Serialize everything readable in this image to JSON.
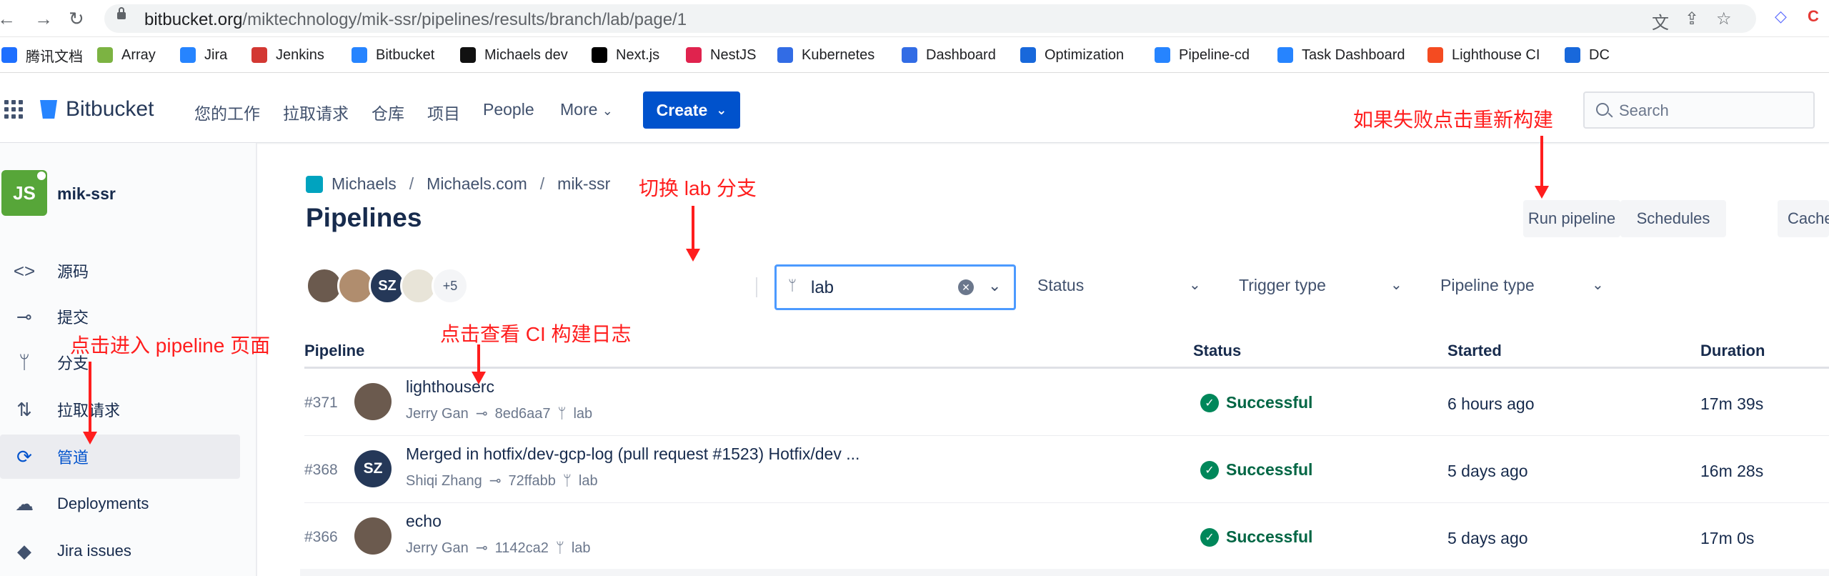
{
  "browser": {
    "url_host": "bitbucket.org",
    "url_path": "/miktechnology/mik-ssr/pipelines/results/branch/lab/page/1",
    "bookmarks": [
      {
        "label": "腾讯文档",
        "color": "#1e6fff"
      },
      {
        "label": "Array",
        "color": "#7cb342"
      },
      {
        "label": "Jira",
        "color": "#2684ff"
      },
      {
        "label": "Jenkins",
        "color": "#d33833"
      },
      {
        "label": "Bitbucket",
        "color": "#2684ff"
      },
      {
        "label": "Michaels dev",
        "color": "#111111"
      },
      {
        "label": "Next.js",
        "color": "#000000"
      },
      {
        "label": "NestJS",
        "color": "#e0234e"
      },
      {
        "label": "Kubernetes",
        "color": "#326ce5"
      },
      {
        "label": "Dashboard",
        "color": "#326ce5"
      },
      {
        "label": "Optimization",
        "color": "#1868db"
      },
      {
        "label": "Pipeline-cd",
        "color": "#2684ff"
      },
      {
        "label": "Task Dashboard",
        "color": "#2684ff"
      },
      {
        "label": "Lighthouse CI",
        "color": "#f44b21"
      },
      {
        "label": "DC",
        "color": "#1868db"
      }
    ]
  },
  "topnav": {
    "logo": "Bitbucket",
    "items": [
      "您的工作",
      "拉取请求",
      "仓库",
      "项目",
      "People",
      "More"
    ],
    "create_label": "Create",
    "search_placeholder": "Search"
  },
  "sidebar": {
    "repo_name": "mik-ssr",
    "repo_icon_text": "JS",
    "items": [
      {
        "label": "源码",
        "icon": "code-icon"
      },
      {
        "label": "提交",
        "icon": "commit-icon"
      },
      {
        "label": "分支",
        "icon": "branch-icon"
      },
      {
        "label": "拉取请求",
        "icon": "pull-request-icon"
      },
      {
        "label": "管道",
        "icon": "pipelines-icon"
      },
      {
        "label": "Deployments",
        "icon": "deployments-icon"
      },
      {
        "label": "Jira issues",
        "icon": "jira-icon"
      }
    ]
  },
  "main": {
    "breadcrumbs": [
      "Michaels",
      "Michaels.com",
      "mik-ssr"
    ],
    "title": "Pipelines",
    "buttons": {
      "run": "Run pipeline",
      "schedules": "Schedules",
      "caches": "Caches"
    },
    "avatars": [
      {
        "initials": "",
        "color": "#6b5a4e"
      },
      {
        "initials": "",
        "color": "#b08d6e"
      },
      {
        "initials": "SZ",
        "color": "#253858"
      },
      {
        "initials": "",
        "color": "#e8e4d8"
      }
    ],
    "avatars_more": "+5",
    "filters": {
      "branch_value": "lab",
      "status": "Status",
      "trigger": "Trigger type",
      "pipeline_type": "Pipeline type"
    },
    "table": {
      "headers": {
        "pipeline": "Pipeline",
        "status": "Status",
        "started": "Started",
        "duration": "Duration"
      },
      "rows": [
        {
          "num": "#371",
          "title": "lighthouserc",
          "author": "Jerry Gan",
          "commit": "8ed6aa7",
          "branch": "lab",
          "status": "Successful",
          "started": "6 hours ago",
          "duration": "17m 39s",
          "avatar_initials": "",
          "avatar_color": "#6b5a4e"
        },
        {
          "num": "#368",
          "title": "Merged in hotfix/dev-gcp-log (pull request #1523) Hotfix/dev ...",
          "author": "Shiqi Zhang",
          "commit": "72ffabb",
          "branch": "lab",
          "status": "Successful",
          "started": "5 days ago",
          "duration": "16m 28s",
          "avatar_initials": "SZ",
          "avatar_color": "#253858"
        },
        {
          "num": "#366",
          "title": "echo",
          "author": "Jerry Gan",
          "commit": "1142ca2",
          "branch": "lab",
          "status": "Successful",
          "started": "5 days ago",
          "duration": "17m 0s",
          "avatar_initials": "",
          "avatar_color": "#6b5a4e"
        }
      ]
    }
  },
  "annotations": {
    "rebuild": "如果失败点击重新构建",
    "switch_branch": "切换 lab 分支",
    "view_log": "点击查看 CI 构建日志",
    "enter_pipeline": "点击进入 pipeline 页面"
  }
}
